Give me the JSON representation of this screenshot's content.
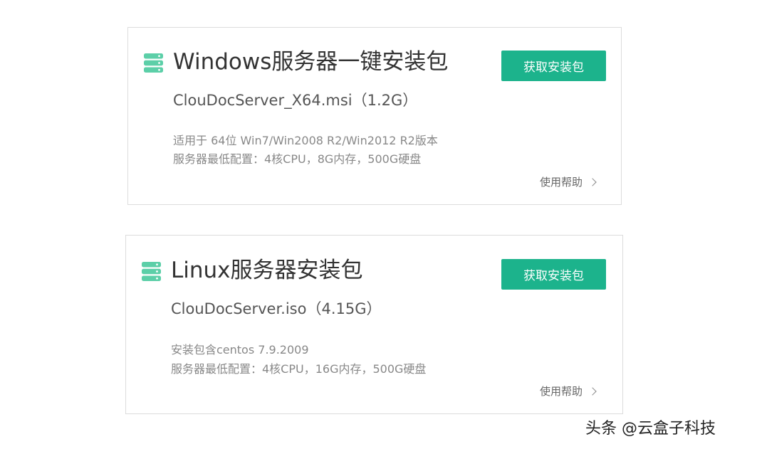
{
  "colors": {
    "accent": "#1cb38c",
    "icon": "#5ccfa8",
    "border": "#dcdcdc"
  },
  "cards": [
    {
      "icon": "server-stack-icon",
      "title": "Windows服务器一键安装包",
      "file": "ClouDocServer_X64.msi（1.2G）",
      "req_1": "适用于 64位 Win7/Win2008 R2/Win2012 R2版本",
      "req_2": "服务器最低配置：4核CPU，8G内存，500G硬盘",
      "button_label": "获取安装包",
      "help_label": "使用帮助"
    },
    {
      "icon": "server-stack-icon",
      "title": "Linux服务器安装包",
      "file": "ClouDocServer.iso（4.15G）",
      "req_1": "安装包含centos 7.9.2009",
      "req_2": "服务器最低配置：4核CPU，16G内存，500G硬盘",
      "button_label": "获取安装包",
      "help_label": "使用帮助"
    }
  ],
  "watermark": "头条 @云盒子科技"
}
